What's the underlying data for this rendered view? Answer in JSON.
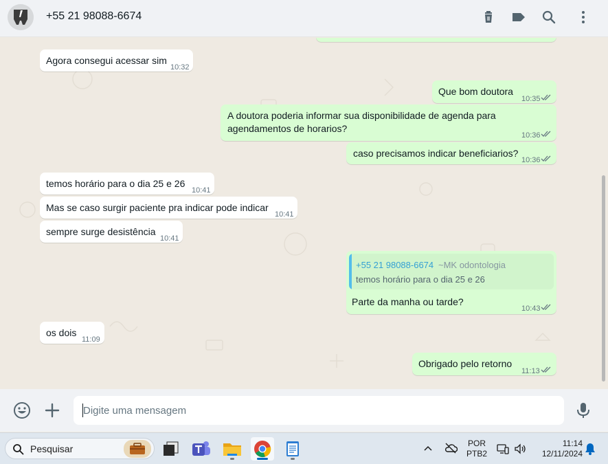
{
  "header": {
    "contact_name": "+55 21 98088-6674",
    "icons": [
      "delete-icon",
      "label-icon",
      "search-icon",
      "menu-icon"
    ]
  },
  "messages": [
    {
      "direction": "in",
      "text": "Agora consegui acessar sim",
      "time": "10:32"
    },
    {
      "direction": "out",
      "text": "Que bom doutora",
      "time": "10:35",
      "status": "read"
    },
    {
      "direction": "out",
      "lines": [
        "A doutora poderia informar sua disponibilidade de agenda para",
        "agendamentos de horarios?"
      ],
      "time": "10:36",
      "status": "read"
    },
    {
      "direction": "out",
      "text": "caso precisamos indicar beneficiarios?",
      "time": "10:36",
      "status": "read"
    },
    {
      "direction": "in",
      "text": "temos horário para o dia 25 e 26",
      "time": "10:41"
    },
    {
      "direction": "in",
      "text": "Mas se caso surgir paciente pra indicar pode indicar",
      "time": "10:41"
    },
    {
      "direction": "in",
      "text": "sempre surge desistência",
      "time": "10:41"
    },
    {
      "direction": "out",
      "quote": {
        "author": "+55 21 98088-6674",
        "tag": "~MK odontologia",
        "text": "temos horário para o dia 25 e 26"
      },
      "text": "Parte da manha ou tarde?",
      "time": "10:43",
      "status": "read"
    },
    {
      "direction": "in",
      "text": "os dois",
      "time": "11:09"
    },
    {
      "direction": "out",
      "text": "Obrigado pelo retorno",
      "time": "11:13",
      "status": "read"
    }
  ],
  "composer": {
    "placeholder": "Digite uma mensagem",
    "icons": [
      "emoji-icon",
      "attach-plus-icon",
      "microphone-icon"
    ]
  },
  "taskbar": {
    "search_label": "Pesquisar",
    "apps": [
      "briefcase-icon",
      "terminal-icon",
      "teams-icon",
      "file-explorer-icon",
      "chrome-icon",
      "notepad-icon"
    ],
    "language_line1": "POR",
    "language_line2": "PTB2",
    "time": "11:14",
    "date": "12/11/2024"
  },
  "colors": {
    "incoming_bubble": "#ffffff",
    "outgoing_bubble": "#d9fdd3",
    "chat_background": "#efeae2",
    "read_tick": "#667781",
    "quote_author": "#35a0d4"
  }
}
